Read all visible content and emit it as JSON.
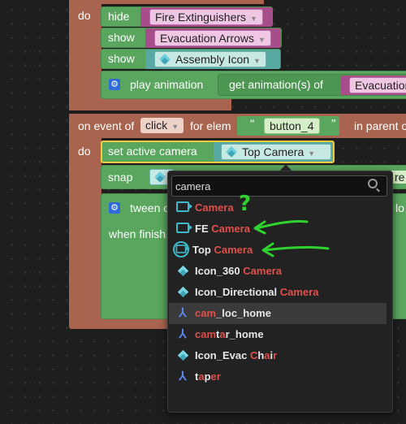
{
  "top_block": {
    "do_label": "do",
    "rows": [
      {
        "action": "show_hide",
        "action_label": "hide",
        "target": "Fire Extinguishers"
      },
      {
        "action": "show_hide",
        "action_label": "show",
        "target": "Evacuation Arrows"
      },
      {
        "action": "show_hide",
        "action_label": "show",
        "target": "Assembly Icon"
      }
    ],
    "play_label": "play animation",
    "get_label": "get animation(s) of",
    "get_target": "Evacuation"
  },
  "event_block": {
    "on_event_label": "on event of",
    "event_value": "click",
    "for_elem_label": "for elem",
    "quote_open": "“",
    "quote_close": "”",
    "elem_value": "button_4",
    "in_parent_label": "in parent o",
    "do_label": "do",
    "set_camera_label": "set active camera",
    "camera_value": "Top Camera",
    "snap_label": "snap",
    "snap_right_text": "re",
    "tween_label": "tween c",
    "tween_right_text": "lo",
    "when_finished_label": "when finish"
  },
  "dropdown": {
    "search_value": "camera",
    "items": [
      {
        "icon": "camera-icon",
        "parts": [
          [
            "Camera",
            true
          ]
        ]
      },
      {
        "icon": "camera-icon",
        "parts": [
          [
            "FE ",
            false
          ],
          [
            "Camera",
            true
          ]
        ]
      },
      {
        "icon": "camera-icon",
        "parts": [
          [
            "Top ",
            false
          ],
          [
            "Camera",
            true
          ]
        ],
        "selected": true
      },
      {
        "icon": "object-icon",
        "parts": [
          [
            "Icon_360 ",
            false
          ],
          [
            "Camera",
            true
          ]
        ]
      },
      {
        "icon": "object-icon",
        "parts": [
          [
            "Icon_Directional ",
            false
          ],
          [
            "Camera",
            true
          ]
        ]
      },
      {
        "icon": "axis-icon",
        "parts": [
          [
            "cam",
            true
          ],
          [
            "_loc_home",
            false
          ]
        ],
        "hovered": true
      },
      {
        "icon": "axis-icon",
        "parts": [
          [
            "cam",
            true
          ],
          [
            "t",
            false
          ],
          [
            "a",
            true
          ],
          [
            "r_home",
            false
          ]
        ]
      },
      {
        "icon": "object-icon",
        "parts": [
          [
            "Icon_Evac ",
            false
          ],
          [
            "C",
            true
          ],
          [
            "h",
            false
          ],
          [
            "a",
            true
          ],
          [
            "i",
            false
          ],
          [
            "r",
            true
          ]
        ]
      },
      {
        "icon": "axis-icon",
        "parts": [
          [
            "t",
            false
          ],
          [
            "a",
            true
          ],
          [
            "p",
            false
          ],
          [
            "e",
            true
          ],
          [
            "r",
            true
          ]
        ]
      }
    ]
  },
  "annotation": {
    "question_mark": "?"
  },
  "colors": {
    "event_brown": "#a8644f",
    "action_green": "#5aa65e",
    "highlight_red": "#e0504a",
    "annotation_green": "#2fd22f"
  }
}
